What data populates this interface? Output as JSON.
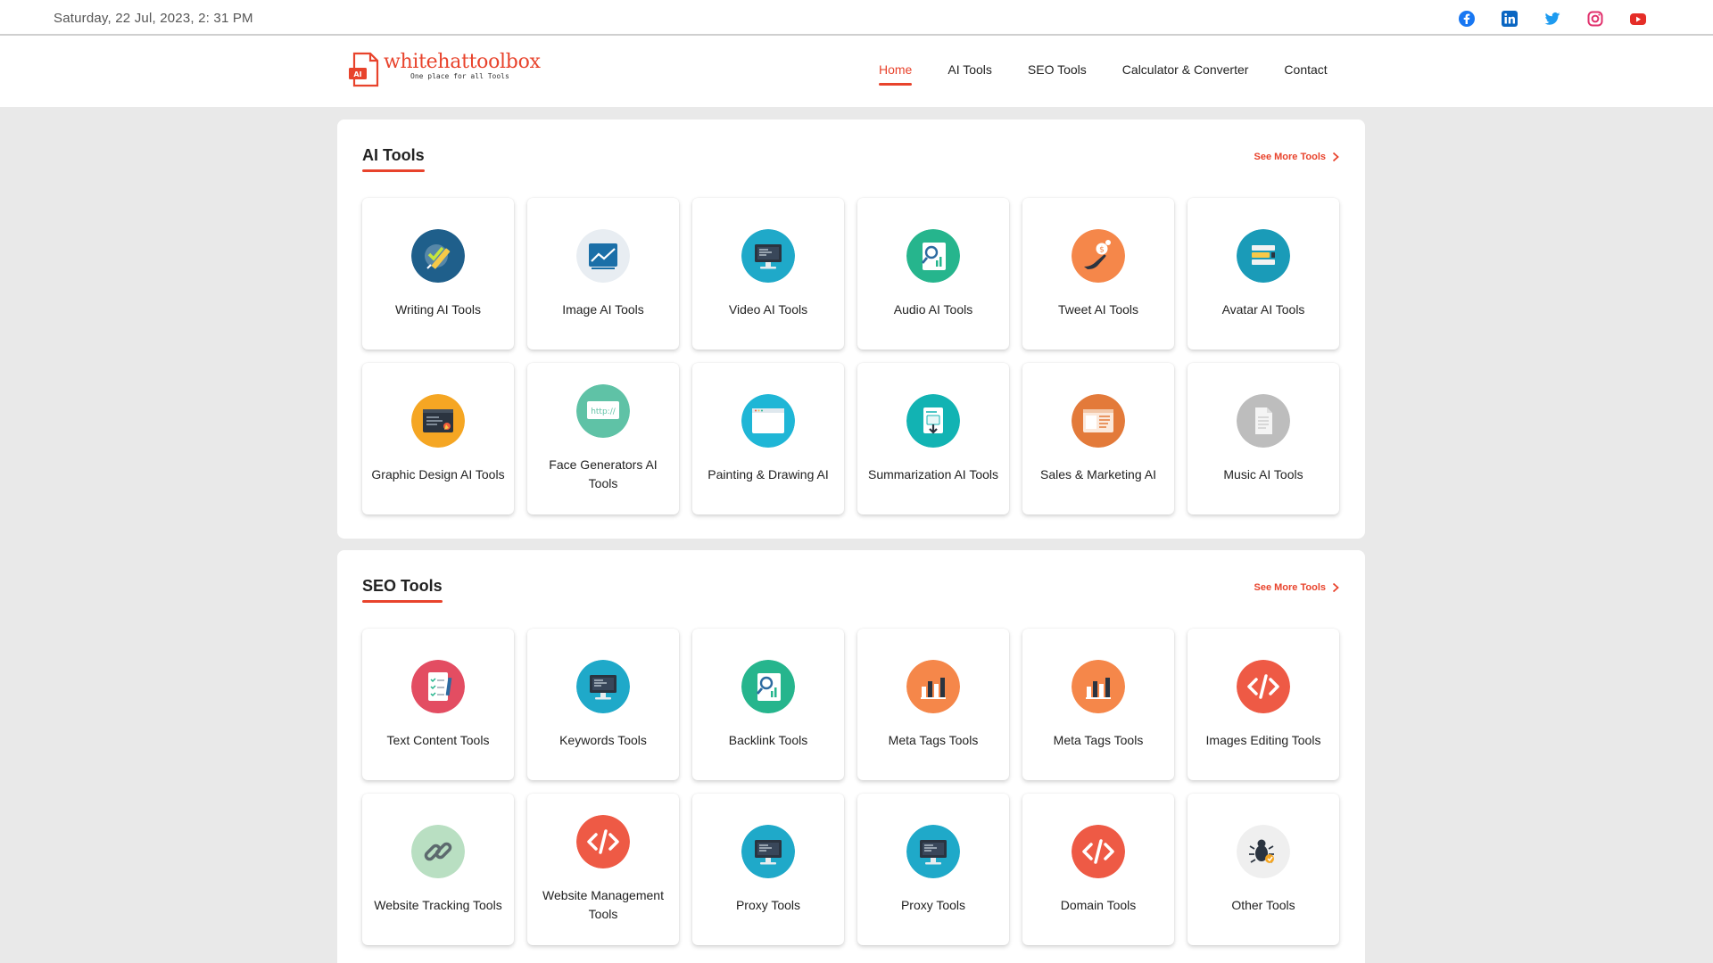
{
  "topbar": {
    "date": "Saturday, 22 Jul, 2023, 2: 31 PM"
  },
  "logo": {
    "name": "whitehattoolbox",
    "tagline": "One place for all Tools",
    "badge": "AI"
  },
  "nav": [
    "Home",
    "AI Tools",
    "SEO Tools",
    "Calculator & Converter",
    "Contact"
  ],
  "ai_tools": {
    "title": "AI Tools",
    "see_more": "See More Tools",
    "items": [
      {
        "label": "Writing AI Tools",
        "icon": "writing-icon",
        "color": "#1f5f8b"
      },
      {
        "label": "Image AI Tools",
        "icon": "image-chart-icon",
        "color": "#e8edf2"
      },
      {
        "label": "Video AI Tools",
        "icon": "monitor-icon",
        "color": "#1fa9c9"
      },
      {
        "label": "Audio AI Tools",
        "icon": "document-search-icon",
        "color": "#26b58d"
      },
      {
        "label": "Tweet AI Tools",
        "icon": "hand-coin-icon",
        "color": "#f5874a"
      },
      {
        "label": "Avatar AI Tools",
        "icon": "stack-icon",
        "color": "#1a9bb8"
      },
      {
        "label": "Graphic Design AI Tools",
        "icon": "design-window-icon",
        "color": "#f5a623"
      },
      {
        "label": "Face Generators AI Tools",
        "icon": "http-icon",
        "color": "#5fc2a6"
      },
      {
        "label": "Painting & Drawing AI",
        "icon": "browser-window-icon",
        "color": "#1fb6d6"
      },
      {
        "label": "Summarization AI Tools",
        "icon": "download-doc-icon",
        "color": "#12b3b3"
      },
      {
        "label": "Sales & Marketing AI",
        "icon": "webpage-icon",
        "color": "#e37a3a"
      },
      {
        "label": "Music AI Tools",
        "icon": "file-icon",
        "color": "#bdbdbd"
      }
    ]
  },
  "seo_tools": {
    "title": "SEO Tools",
    "see_more": "See More Tools",
    "items": [
      {
        "label": "Text Content Tools",
        "icon": "checklist-icon",
        "color": "#e34d62"
      },
      {
        "label": "Keywords Tools",
        "icon": "monitor-icon",
        "color": "#1fa9c9"
      },
      {
        "label": "Backlink Tools",
        "icon": "document-search-icon",
        "color": "#26b58d"
      },
      {
        "label": "Meta Tags Tools",
        "icon": "bar-chart-icon",
        "color": "#f5874a"
      },
      {
        "label": "Meta Tags Tools",
        "icon": "bar-chart-icon",
        "color": "#f5874a"
      },
      {
        "label": "Images Editing Tools",
        "icon": "code-icon",
        "color": "#ee5a45"
      },
      {
        "label": "Website Tracking Tools",
        "icon": "link-icon",
        "color": "#b9dfc2"
      },
      {
        "label": "Website Management Tools",
        "icon": "code-icon",
        "color": "#ee5a45"
      },
      {
        "label": "Proxy Tools",
        "icon": "monitor-icon",
        "color": "#1fa9c9"
      },
      {
        "label": "Proxy Tools",
        "icon": "monitor-icon",
        "color": "#1fa9c9"
      },
      {
        "label": "Domain Tools",
        "icon": "code-icon",
        "color": "#ee5a45"
      },
      {
        "label": "Other Tools",
        "icon": "bug-icon",
        "color": "#efefef"
      }
    ]
  },
  "social": [
    "facebook-icon",
    "linkedin-icon",
    "twitter-icon",
    "instagram-icon",
    "youtube-icon"
  ],
  "colors": {
    "accent": "#e8432c",
    "background": "#e9e9e9"
  }
}
